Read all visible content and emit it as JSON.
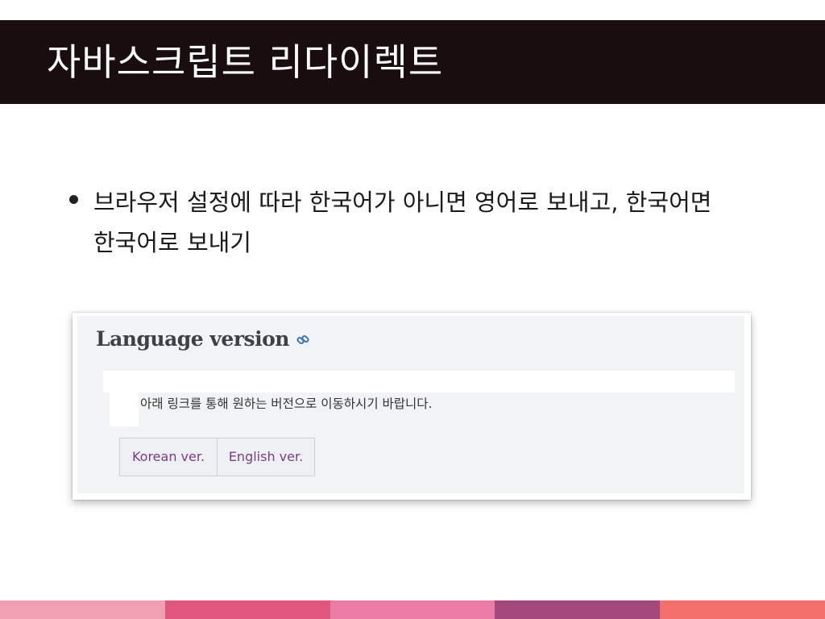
{
  "slide": {
    "title": "자바스크립트 리다이렉트",
    "bullet_text": "브라우저 설정에 따라 한국어가 아니면 영어로 보내고, 한국어면 한국어로 보내기"
  },
  "screenshot": {
    "section_title": "Language version",
    "link_icon": "link-icon",
    "instruction": "아래 링크를 통해 원하는 버전으로 이동하시기 바랍니다.",
    "buttons": [
      "Korean ver.",
      "English ver."
    ]
  },
  "colors": {
    "title_bar": "#1a0d0f",
    "link_text": "#7b3a8c",
    "stripe": [
      "#f1a0b3",
      "#e2577f",
      "#ea7ca5",
      "#a4477a",
      "#f36f6b"
    ]
  }
}
